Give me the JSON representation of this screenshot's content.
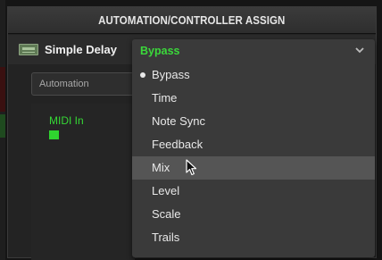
{
  "window": {
    "title": "AUTOMATION/CONTROLLER ASSIGN"
  },
  "block": {
    "name": "Simple Delay",
    "icon": "delay-block-icon"
  },
  "parameter_dropdown": {
    "selected": "Bypass",
    "chevron": "chevron-down-icon",
    "hovered": "Mix",
    "options": [
      "Bypass",
      "Time",
      "Note Sync",
      "Feedback",
      "Mix",
      "Level",
      "Scale",
      "Trails"
    ]
  },
  "automation": {
    "label": "Automation"
  },
  "controller": {
    "label": "MIDI In"
  },
  "colors": {
    "accent_green": "#3bd83b",
    "title_bar": "#353535",
    "dropdown_bg": "#3a3a3a",
    "hover_bg": "#555555"
  }
}
